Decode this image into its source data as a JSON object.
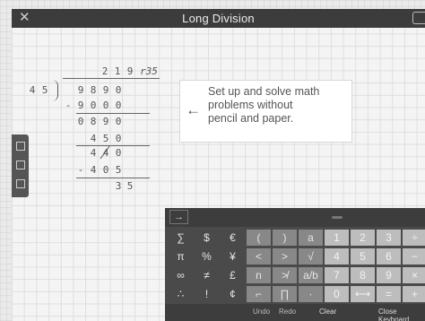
{
  "window": {
    "title": "Long Division",
    "close_glyph": "✕"
  },
  "problem": {
    "quotient": [
      "2",
      "1",
      "9"
    ],
    "remainder_text": "r35",
    "divisor": [
      "4",
      "5"
    ],
    "dividend": [
      "9",
      "8",
      "9",
      "0"
    ],
    "step1": [
      "-",
      "9",
      "0",
      "0",
      "0"
    ],
    "step2": [
      "0",
      "8",
      "9",
      "0"
    ],
    "step3": [
      "4",
      "5",
      "0"
    ],
    "step4": [
      "4",
      "4",
      "0"
    ],
    "step5": [
      "-",
      "4",
      "0",
      "5"
    ],
    "step6": [
      "3",
      "5"
    ]
  },
  "hint": {
    "text_lines": [
      "Set up and solve math",
      "problems without",
      "pencil and paper."
    ],
    "arrow": "←"
  },
  "keyboard": {
    "rows": [
      [
        "∑",
        "$",
        "€",
        "(",
        ")",
        "a",
        "1",
        "2",
        "3",
        "÷"
      ],
      [
        "π",
        "%",
        "¥",
        "<",
        ">",
        "√",
        "4",
        "5",
        "6",
        "−"
      ],
      [
        "∞",
        "≠",
        "£",
        "n",
        "≯",
        "a/b",
        "7",
        "8",
        "9",
        "×"
      ],
      [
        "∴",
        "!",
        "¢",
        "⌐",
        "∏",
        "∙",
        "0",
        "⟷",
        "=",
        "+"
      ]
    ],
    "bottom": {
      "undo": "Undo",
      "redo": "Redo",
      "clear": "Clear",
      "close": "Close Keyboard"
    },
    "arrow_button": "→"
  }
}
